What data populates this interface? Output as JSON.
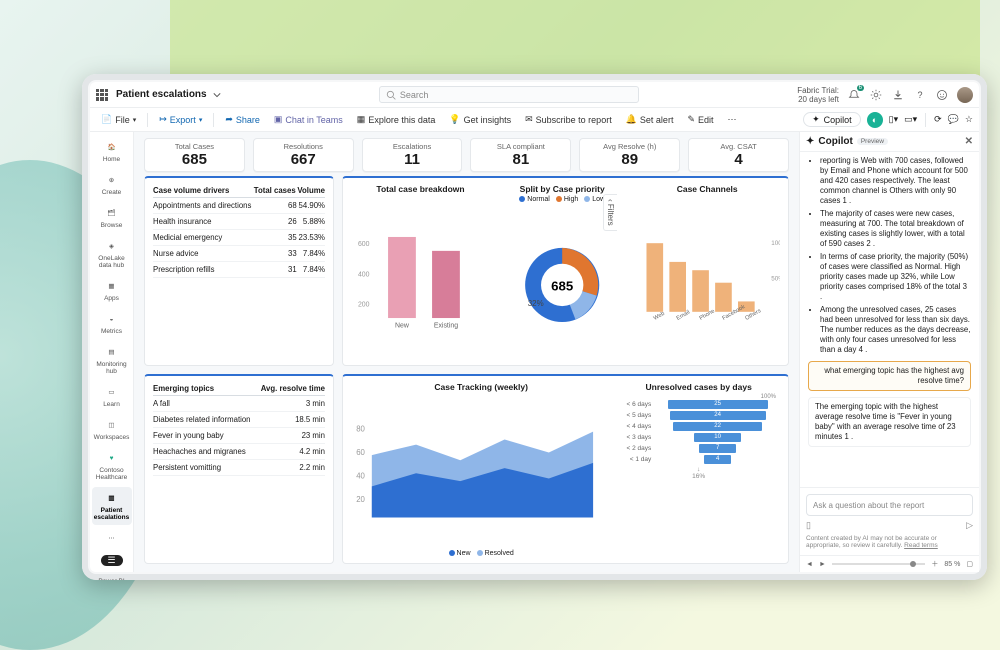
{
  "header": {
    "workspace": "Patient escalations",
    "search_placeholder": "Search",
    "trial_line1": "Fabric Trial:",
    "trial_line2": "20 days left",
    "notify_count": "6"
  },
  "cmd": {
    "file": "File",
    "export": "Export",
    "share": "Share",
    "chat": "Chat in Teams",
    "explore": "Explore this data",
    "insights": "Get insights",
    "subscribe": "Subscribe to report",
    "alert": "Set alert",
    "edit": "Edit",
    "copilot": "Copilot"
  },
  "nav": {
    "home": "Home",
    "create": "Create",
    "browse": "Browse",
    "onelake": "OneLake data hub",
    "apps": "Apps",
    "metrics": "Metrics",
    "monitor": "Monitoring hub",
    "learn": "Learn",
    "workspaces": "Workspaces",
    "contoso": "Contoso Healthcare",
    "patient": "Patient escalations",
    "powerbi": "Power BI"
  },
  "kpi": [
    {
      "label": "Total Cases",
      "value": "685"
    },
    {
      "label": "Resolutions",
      "value": "667"
    },
    {
      "label": "Escalations",
      "value": "11"
    },
    {
      "label": "SLA compliant",
      "value": "81"
    },
    {
      "label": "Avg Resolve (h)",
      "value": "89"
    },
    {
      "label": "Avg. CSAT",
      "value": "4"
    }
  ],
  "drivers": {
    "title": "Case volume drivers",
    "h1": "Total cases",
    "h2": "Volume",
    "rows": [
      {
        "name": "Appointments and directions",
        "cases": "68",
        "vol": "54.90%"
      },
      {
        "name": "Health insurance",
        "cases": "26",
        "vol": "5.88%"
      },
      {
        "name": "Medicial emergency",
        "cases": "35",
        "vol": "23.53%"
      },
      {
        "name": "Nurse advice",
        "cases": "33",
        "vol": "7.84%"
      },
      {
        "name": "Prescription refills",
        "cases": "31",
        "vol": "7.84%"
      }
    ]
  },
  "emerging": {
    "title": "Emerging topics",
    "h1": "Avg. resolve time",
    "rows": [
      {
        "name": "A fall",
        "t": "3 min"
      },
      {
        "name": "Diabetes related information",
        "t": "18.5 min"
      },
      {
        "name": "Fever in young baby",
        "t": "23 min"
      },
      {
        "name": "Heachaches and migranes",
        "t": "4.2 min"
      },
      {
        "name": "Persistent vomitting",
        "t": "2.2 min"
      }
    ]
  },
  "breakdown": {
    "title": "Total case breakdown",
    "xlabels": [
      "New",
      "Existing"
    ]
  },
  "priority": {
    "title": "Split by Case priority",
    "legend": [
      "Normal",
      "High",
      "Low"
    ],
    "center": "685",
    "pct": "32%"
  },
  "channels": {
    "title": "Case Channels",
    "xlabels": [
      "Web",
      "Email",
      "Phone",
      "Facebook",
      "Others"
    ]
  },
  "tracking": {
    "title": "Case Tracking (weekly)",
    "legend": [
      "New",
      "Resolved"
    ]
  },
  "unresolved": {
    "title": "Unresolved cases by days",
    "pct_label": "100%",
    "rows": [
      {
        "label": "< 6 days",
        "v": "25"
      },
      {
        "label": "< 5 days",
        "v": "24"
      },
      {
        "label": "< 4 days",
        "v": "22"
      },
      {
        "label": "< 3 days",
        "v": "10"
      },
      {
        "label": "< 2 days",
        "v": "7"
      },
      {
        "label": "< 1 day",
        "v": "4"
      }
    ],
    "footer": "16%"
  },
  "filters_label": "Filters",
  "copilot": {
    "title": "Copilot",
    "preview": "Preview",
    "b1": "reporting is Web with 700 cases, followed by Email and Phone which account for 500 and 420 cases respectively. The least common channel is Others with only 90 cases  1 .",
    "b2": "The majority of cases were new cases, measuring at 700. The total breakdown of existing cases is slightly lower, with a total of 590 cases  2 .",
    "b3": "In terms of case priority, the majority (50%) of cases were classified as Normal. High priority cases made up 32%, while Low priority cases comprised 18% of the total  3 .",
    "b4": "Among the unresolved cases, 25 cases had been unresolved for less than six days. The number reduces as the days decrease, with only four cases unresolved for less than a day  4 .",
    "user_q": "what emerging topic has the highest avg resolve time?",
    "answer": "The emerging topic with the highest average resolve time is \"Fever in young baby\" with an average resolve time of 23 minutes  1 .",
    "placeholder": "Ask a question about the report",
    "disclaimer": "Content created by AI may not be accurate or appropriate, so review it carefully.",
    "terms": "Read terms",
    "zoom": "85 %"
  },
  "chart_data": [
    {
      "type": "bar",
      "title": "Total case breakdown",
      "categories": [
        "New",
        "Existing"
      ],
      "values": [
        700,
        590
      ],
      "ylim": [
        0,
        700
      ],
      "yticks": [
        200,
        400,
        600
      ]
    },
    {
      "type": "pie",
      "title": "Split by Case priority",
      "series": [
        {
          "name": "Normal",
          "value": 50
        },
        {
          "name": "High",
          "value": 32
        },
        {
          "name": "Low",
          "value": 18
        }
      ],
      "center_label": "685"
    },
    {
      "type": "bar",
      "title": "Case Channels",
      "categories": [
        "Web",
        "Email",
        "Phone",
        "Facebook",
        "Others"
      ],
      "values": [
        700,
        500,
        420,
        300,
        90
      ],
      "ylim": [
        0,
        700
      ],
      "pct_ticks": [
        "50%",
        "100%"
      ]
    },
    {
      "type": "area",
      "title": "Case Tracking (weekly)",
      "x": [
        1,
        2,
        3,
        4,
        5,
        6
      ],
      "series": [
        {
          "name": "New",
          "values": [
            55,
            62,
            50,
            66,
            58,
            72
          ]
        },
        {
          "name": "Resolved",
          "values": [
            30,
            40,
            34,
            46,
            38,
            52
          ]
        }
      ],
      "ylim": [
        0,
        80
      ],
      "yticks": [
        20,
        40,
        60,
        80
      ]
    },
    {
      "type": "bar",
      "title": "Unresolved cases by days",
      "categories": [
        "< 6 days",
        "< 5 days",
        "< 4 days",
        "< 3 days",
        "< 2 days",
        "< 1 day"
      ],
      "values": [
        25,
        24,
        22,
        10,
        7,
        4
      ],
      "orientation": "horizontal",
      "xlim": [
        0,
        25
      ]
    }
  ]
}
